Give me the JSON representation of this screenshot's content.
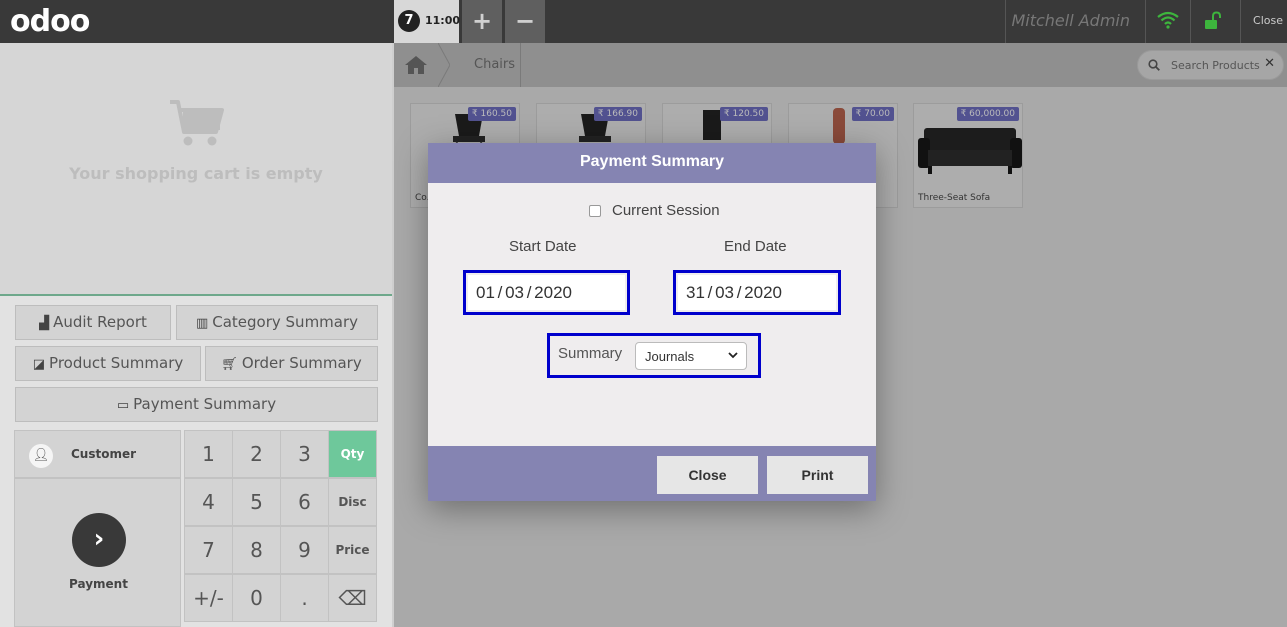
{
  "topbar": {
    "logo": "odoo",
    "order_number": "7",
    "order_time": "11:00",
    "add_order_symbol": "+",
    "remove_order_symbol": "−",
    "user_name": "Mitchell Admin",
    "close_label": "Close",
    "wifi_icon": "wifi-icon",
    "lock_icon": "unlock-icon"
  },
  "cart": {
    "empty_message": "Your shopping cart is empty",
    "icon": "cart-icon"
  },
  "control_buttons": {
    "audit_report": "Audit Report",
    "category_summary": "Category Summary",
    "product_summary": "Product Summary",
    "order_summary": "Order Summary",
    "payment_summary": "Payment Summary"
  },
  "actionpad": {
    "customer_label": "Customer",
    "payment_label": "Payment"
  },
  "numpad": {
    "keys": [
      "1",
      "2",
      "3",
      "4",
      "5",
      "6",
      "7",
      "8",
      "9",
      "+/-",
      "0",
      "."
    ],
    "modes": [
      "Qty",
      "Disc",
      "Price"
    ],
    "backspace": "⌫",
    "active_mode": "Qty"
  },
  "breadcrumb": {
    "category": "Chairs"
  },
  "search": {
    "placeholder": "Search Products"
  },
  "products": [
    {
      "price": "₹ 160.50",
      "name": "Co... (CO..."
    },
    {
      "price": "₹ 166.90",
      "name": ""
    },
    {
      "price": "₹ 120.50",
      "name": ""
    },
    {
      "price": "₹ 70.00",
      "name": ""
    },
    {
      "price": "₹ 60,000.00",
      "name": "Three-Seat Sofa"
    }
  ],
  "modal": {
    "title": "Payment Summary",
    "current_session_label": "Current Session",
    "current_session_checked": false,
    "start_date_label": "Start Date",
    "start_date": "01 / 03 / 2020",
    "end_date_label": "End Date",
    "end_date": "31 / 03 / 2020",
    "summary_label": "Summary",
    "summary_value": "Journals",
    "close_button": "Close",
    "print_button": "Print"
  },
  "colors": {
    "modal_header": "#8584b2",
    "topbar": "#393939",
    "active_mode": "#6ec89b",
    "highlight_border": "#0000cc",
    "price_tag": "#525290"
  }
}
